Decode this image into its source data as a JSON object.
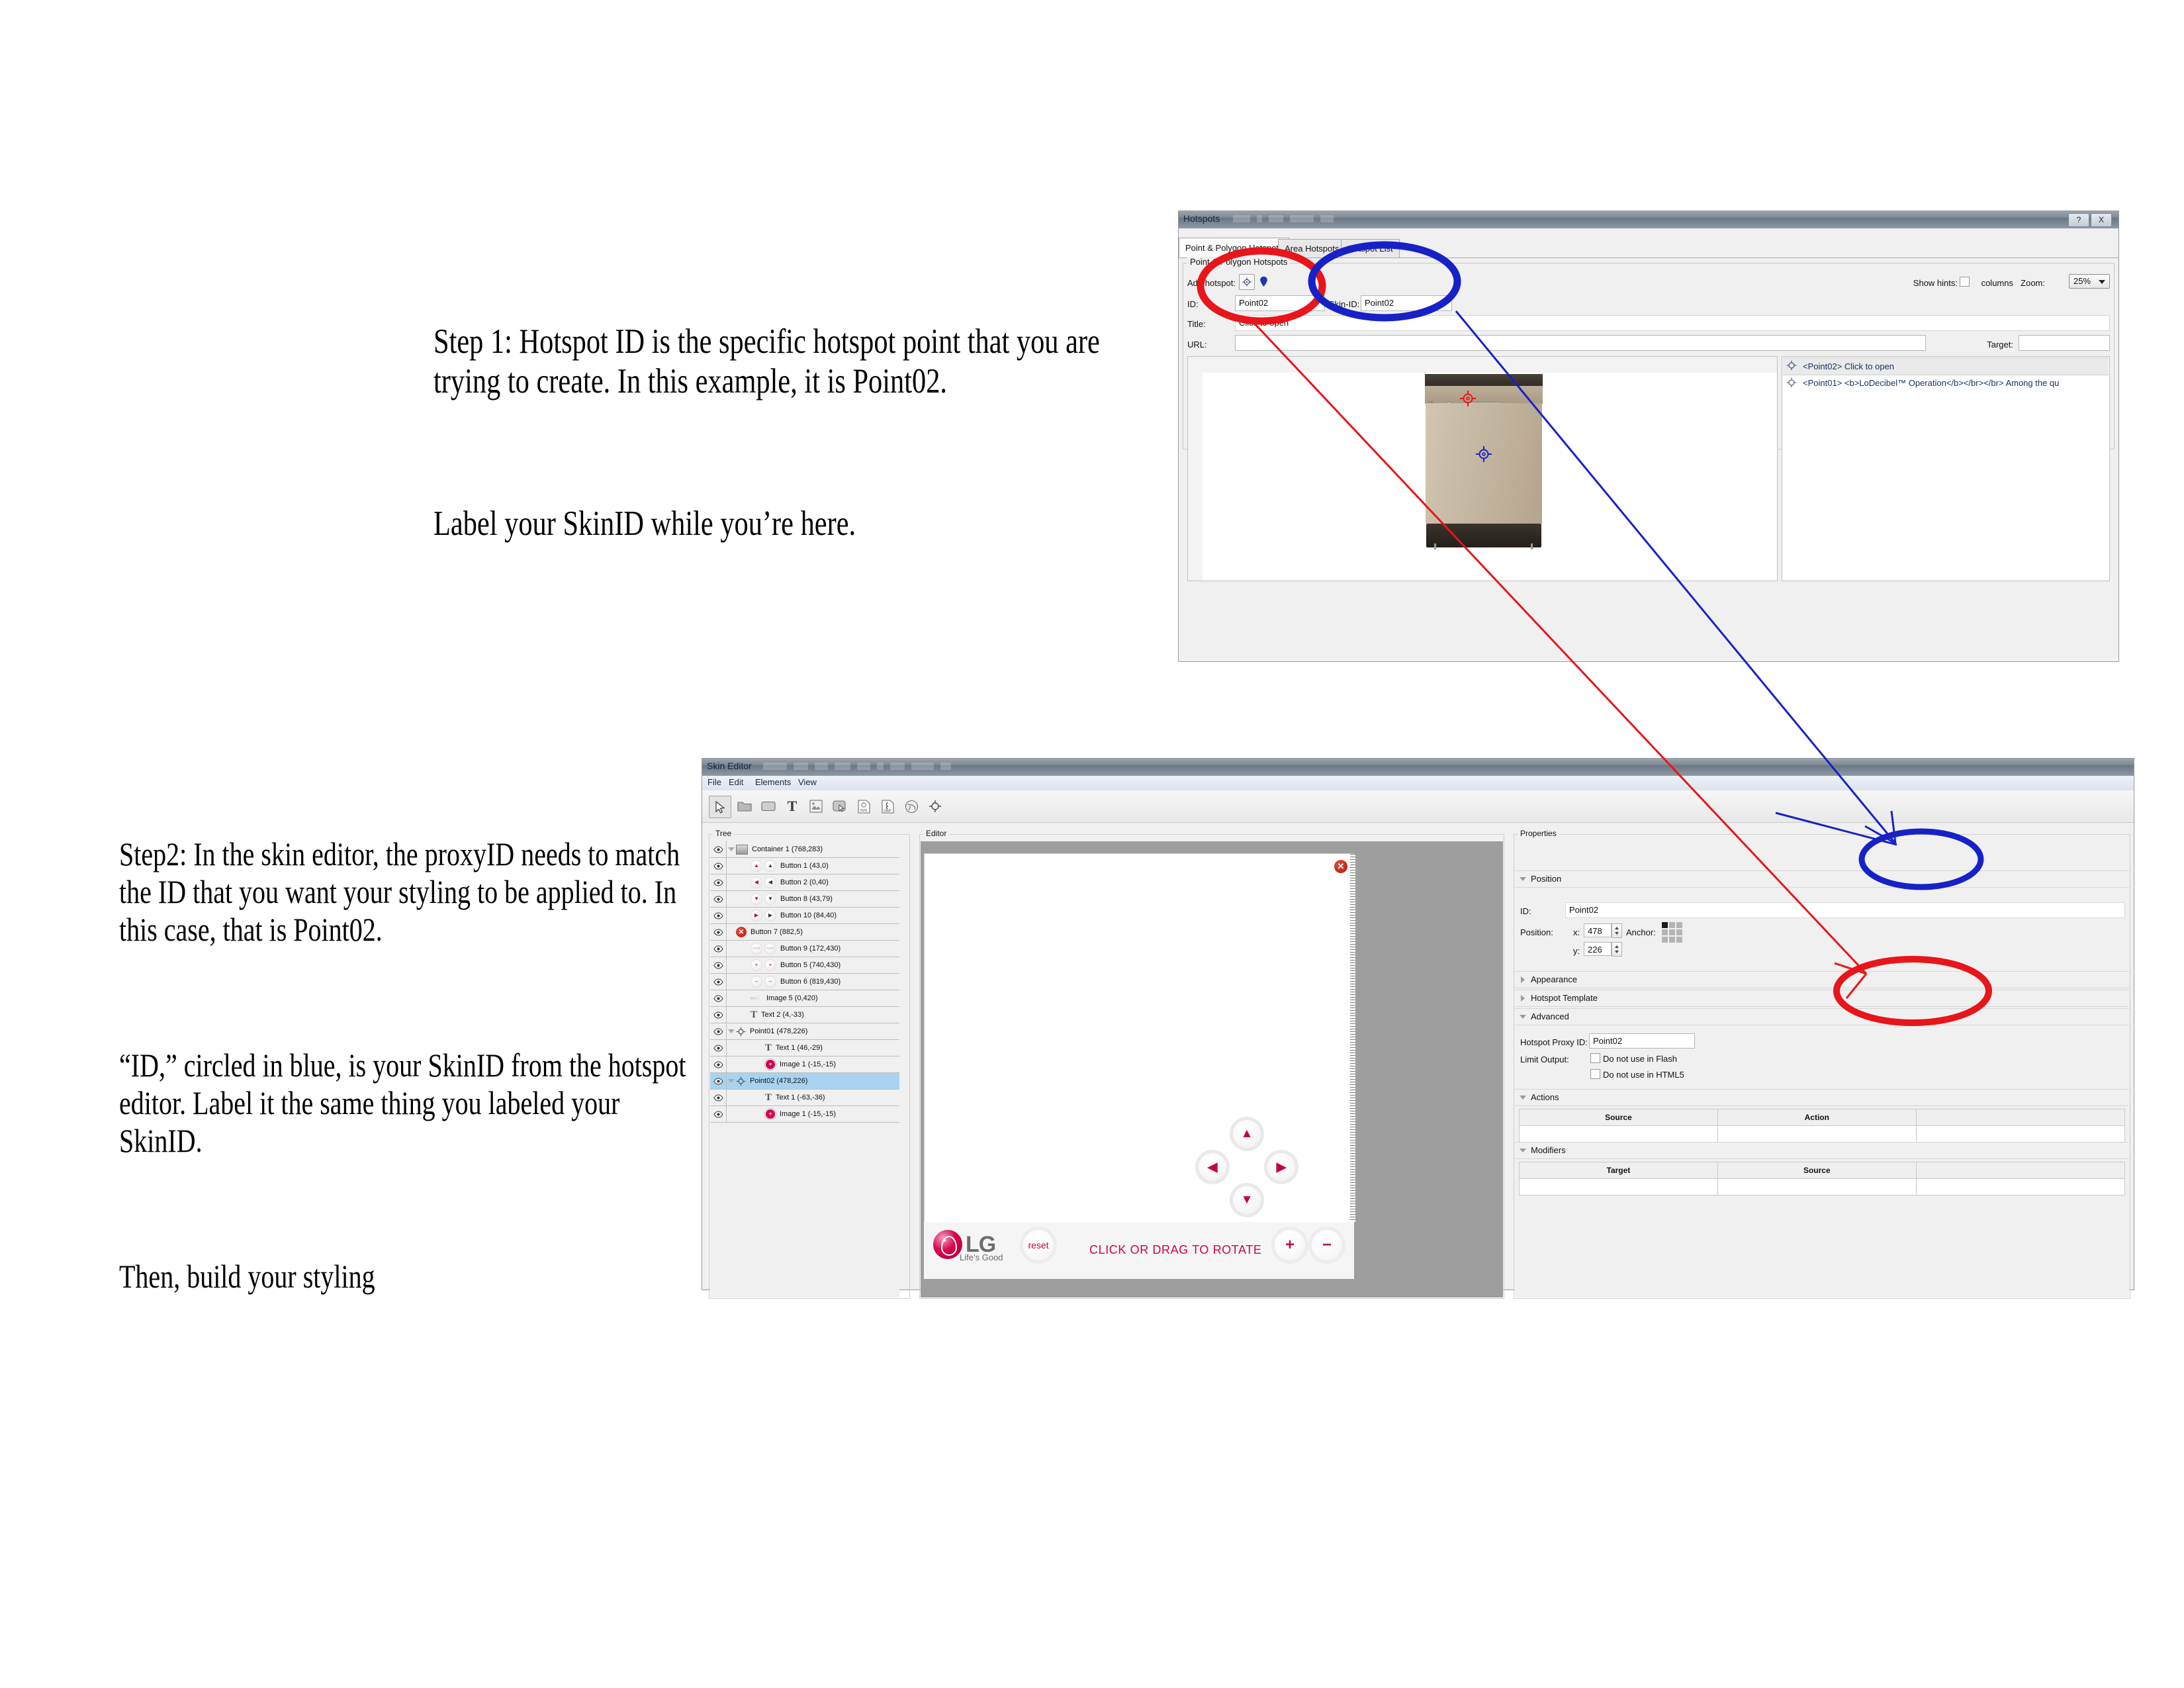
{
  "instructions": {
    "step1": "Step 1: Hotspot ID is the specific hotspot point that you are trying to create. In this example, it is Point02.",
    "step1b": "Label your SkinID while you’re here.",
    "step2": "Step2: In the skin editor, the proxyID needs to match the ID that you want your styling to be applied to. In this case, that is Point02.",
    "step2b": "“ID,” circled in blue, is your SkinID from the hotspot editor. Label it the same thing you labeled your SkinID.",
    "step2c": "Then, build your styling"
  },
  "colors": {
    "annotation_red": "#e8151a",
    "annotation_blue": "#1721c8",
    "accent_magenta": "#c3004c",
    "selection_blue": "#a8d3f0"
  },
  "hotspots_window": {
    "title": "Hotspots",
    "sys_help": "?",
    "sys_close": "X",
    "tabs": [
      {
        "label": "Point & Polygon Hotspots",
        "active": true
      },
      {
        "label": "Area Hotspots",
        "active": false
      },
      {
        "label": "Hotspot List",
        "active": false
      }
    ],
    "group_legend": "Point & Polygon Hotspots",
    "add_hotspot_label": "Add hotspot:",
    "add_point_icon": "crosshair-icon",
    "add_polygon_icon": "pin-icon",
    "show_hints_label": "Show hints:",
    "columns_label": "columns",
    "zoom_label": "Zoom:",
    "zoom_value": "25%",
    "fields": {
      "id_label": "ID:",
      "id_value": "Point02",
      "skin_id_label": "Skin-ID:",
      "skin_id_value": "Point02",
      "title_label": "Title:",
      "title_value": "Click to open",
      "url_label": "URL:",
      "url_value": "",
      "target_label": "Target:",
      "target_value": ""
    },
    "hotspot_list": [
      {
        "text": "<Point02> Click to open",
        "selected": true
      },
      {
        "text": "<Point01> <b>LoDecibel™ Operation</b></br></br> Among the qu",
        "selected": false
      }
    ]
  },
  "skin_editor_window": {
    "title": "Skin Editor",
    "menu": [
      "File",
      "Edit",
      "Elements",
      "View"
    ],
    "toolbar_icons": [
      "pointer-icon",
      "folder-icon",
      "rectangle-icon",
      "text-icon",
      "image-icon",
      "button-icon",
      "svg-file-icon",
      "swf-file-icon",
      "globe-icon",
      "hotspot-icon"
    ],
    "tree_legend": "Tree",
    "editor_legend": "Editor",
    "properties_legend": "Properties",
    "tree_items": [
      {
        "label": "Container 1 (768,283)",
        "icon": "container-icon",
        "indent": 0,
        "twisty": true,
        "selected": false
      },
      {
        "label": "Button 1 (43,0)",
        "icon": "arrow-up-button",
        "indent": 1,
        "twisty": false,
        "selected": false
      },
      {
        "label": "Button 2 (0,40)",
        "icon": "arrow-left-button",
        "indent": 1,
        "twisty": false,
        "selected": false
      },
      {
        "label": "Button 8 (43,79)",
        "icon": "arrow-down-button",
        "indent": 1,
        "twisty": false,
        "selected": false
      },
      {
        "label": "Button 10 (84,40)",
        "icon": "arrow-right-button",
        "indent": 1,
        "twisty": false,
        "selected": false
      },
      {
        "label": "Button 7 (882,5)",
        "icon": "close-x-icon",
        "indent": 0,
        "twisty": false,
        "selected": false
      },
      {
        "label": "Button 9 (172,430)",
        "icon": "reset-button",
        "indent": 1,
        "twisty": false,
        "selected": false
      },
      {
        "label": "Button 5 (740,430)",
        "icon": "plus-button",
        "indent": 1,
        "twisty": false,
        "selected": false
      },
      {
        "label": "Button 6 (819,430)",
        "icon": "minus-button",
        "indent": 1,
        "twisty": false,
        "selected": false
      },
      {
        "label": "Image 5 (0,420)",
        "icon": "image-thumb-icon",
        "indent": 1,
        "twisty": false,
        "selected": false
      },
      {
        "label": "Text 2 (4,-33)",
        "icon": "text-icon",
        "indent": 1,
        "twisty": false,
        "selected": false
      },
      {
        "label": "Point01 (478,226)",
        "icon": "hotspot-icon",
        "indent": 0,
        "twisty": true,
        "selected": false
      },
      {
        "label": "Text 1 (46,-29)",
        "icon": "text-icon",
        "indent": 2,
        "twisty": false,
        "selected": false
      },
      {
        "label": "Image 1 (-15,-15)",
        "icon": "red-plus-icon",
        "indent": 2,
        "twisty": false,
        "selected": false
      },
      {
        "label": "Point02 (478,226)",
        "icon": "hotspot-icon",
        "indent": 0,
        "twisty": true,
        "selected": true
      },
      {
        "label": "Text 1 (-63,-36)",
        "icon": "text-icon",
        "indent": 2,
        "twisty": false,
        "selected": false
      },
      {
        "label": "Image 1 (-15,-15)",
        "icon": "red-plus-icon",
        "indent": 2,
        "twisty": false,
        "selected": false
      }
    ],
    "stage": {
      "close_label": "✕",
      "dpad": {
        "up": "▲",
        "down": "▼",
        "left": "◀",
        "right": "▶"
      },
      "brand_word": "LG",
      "brand_tagline": "Life’s Good",
      "reset_label": "reset",
      "rotate_message": "CLICK OR DRAG TO ROTATE",
      "plus_label": "+",
      "minus_label": "−"
    },
    "properties": {
      "position_section": "Position",
      "id_label": "ID:",
      "id_value": "Point02",
      "position_label": "Position:",
      "x_label": "x:",
      "x_value": "478",
      "y_label": "y:",
      "y_value": "226",
      "anchor_label": "Anchor:",
      "appearance_section": "Appearance",
      "hotspot_template_section": "Hotspot Template",
      "advanced_section": "Advanced",
      "proxy_id_label": "Hotspot Proxy ID:",
      "proxy_id_value": "Point02",
      "limit_output_label": "Limit Output:",
      "no_flash_label": "Do not use in Flash",
      "no_html5_label": "Do not use in HTML5",
      "actions_section": "Actions",
      "actions_columns": [
        "Source",
        "Action"
      ],
      "modifiers_section": "Modifiers",
      "modifiers_columns": [
        "Target",
        "Source"
      ]
    }
  }
}
